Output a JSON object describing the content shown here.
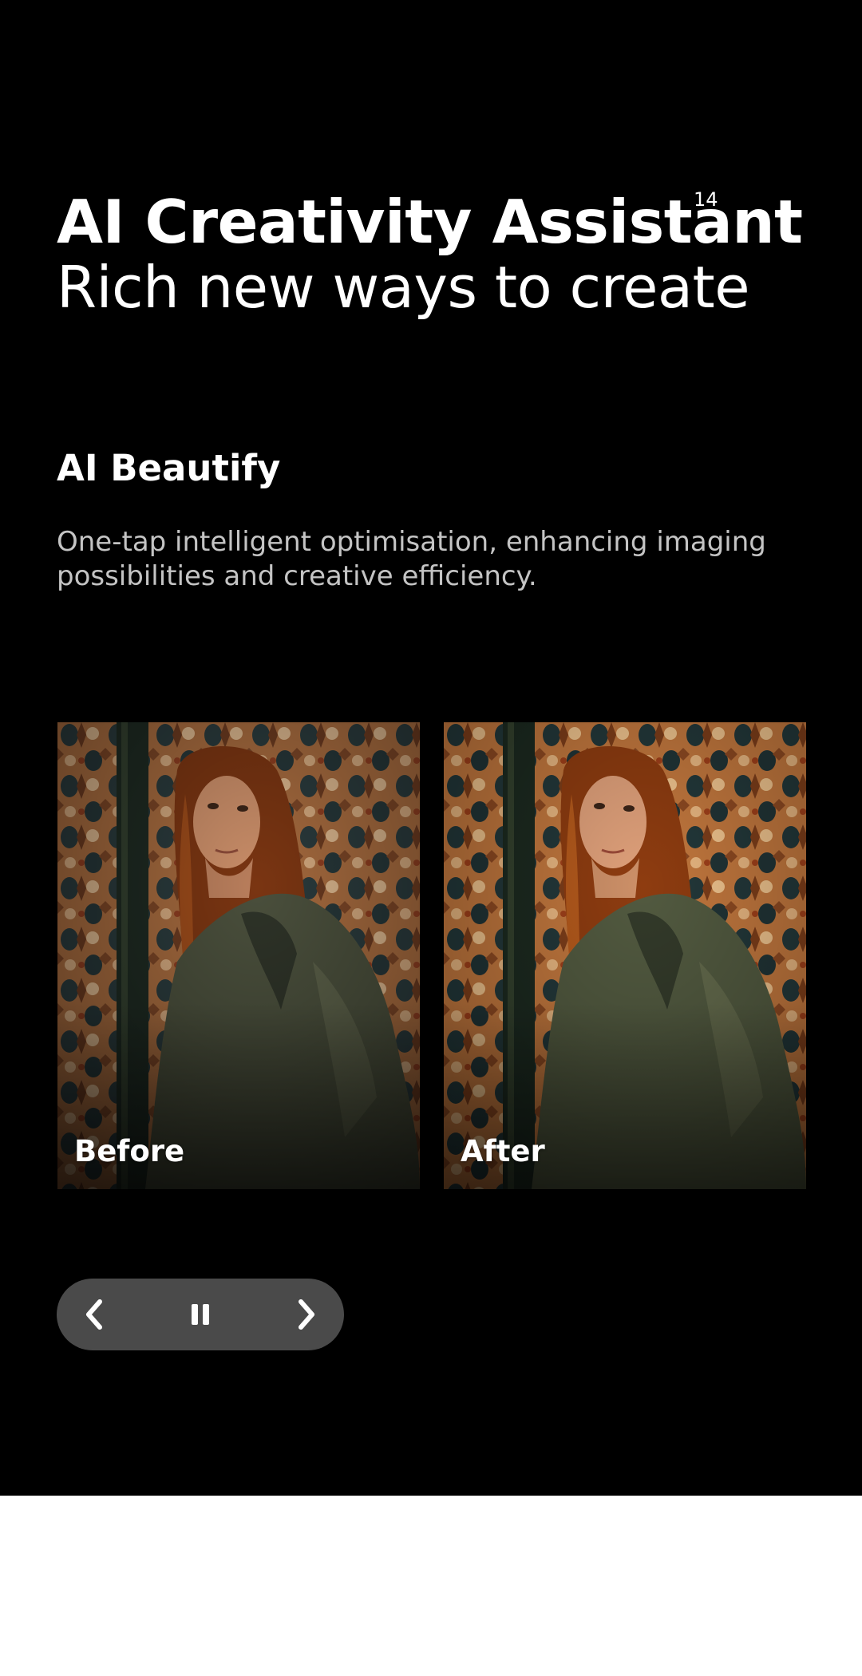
{
  "headline": {
    "title": "AI Creativity Assistant",
    "footnote": "14",
    "subtitle": "Rich new ways to create"
  },
  "feature": {
    "title": "AI Beautify",
    "description": "One-tap intelligent optimisation, enhancing imaging possibilities and creative efficiency."
  },
  "comparison": {
    "before_label": "Before",
    "after_label": "After"
  },
  "controls": {
    "prev_icon": "chevron-left-icon",
    "pause_icon": "pause-icon",
    "next_icon": "chevron-right-icon"
  },
  "colors": {
    "section_background": "#000000",
    "page_background": "#ffffff",
    "control_pill": "#4a4a4a",
    "description_text": "#c4c4c4"
  }
}
